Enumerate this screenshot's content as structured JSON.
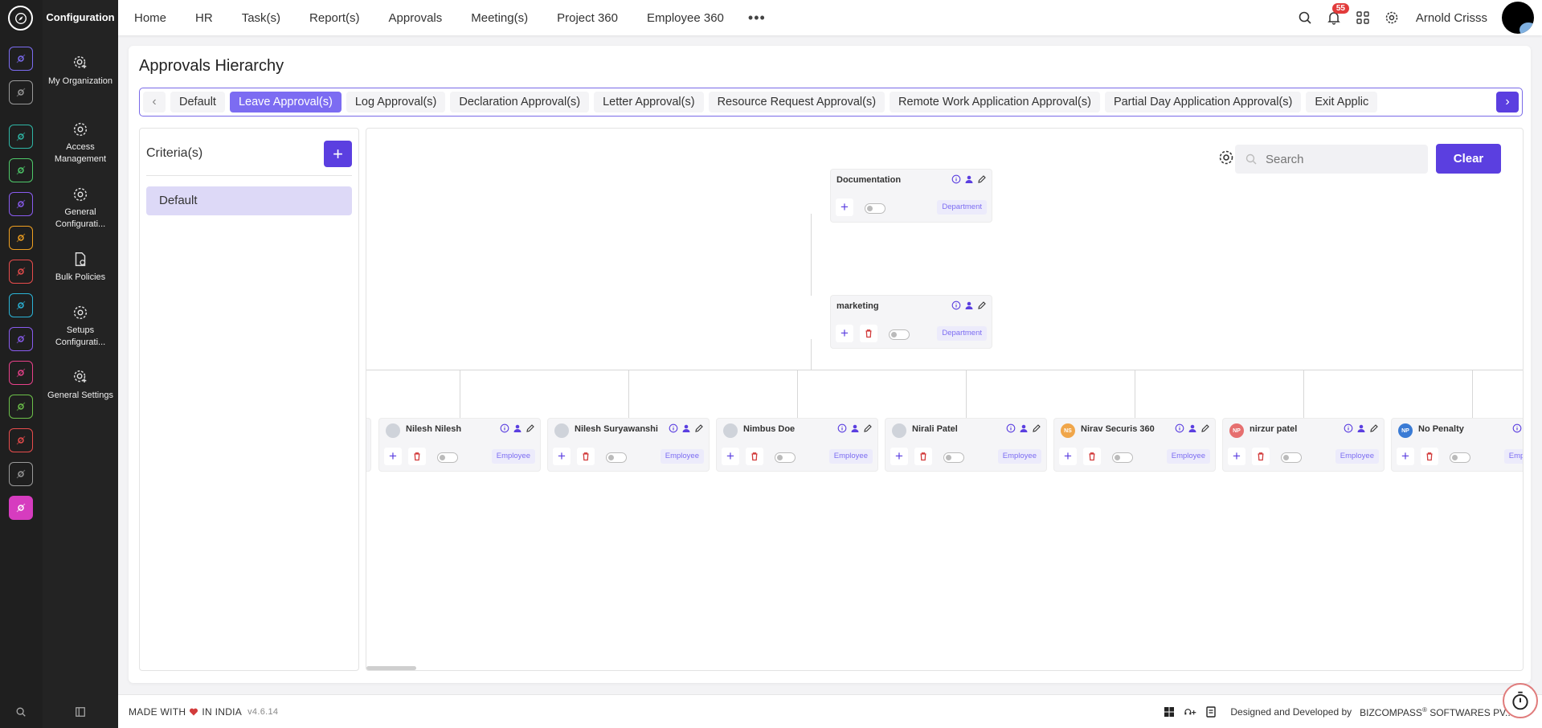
{
  "app": {
    "module_title": "Configuration"
  },
  "colors": {
    "accent": "#5b3fe0",
    "accent_light": "#7c6cf2",
    "danger": "#d23b3b"
  },
  "rail": {
    "icons": [
      {
        "name": "home-icon",
        "color": "#7c6cf2"
      },
      {
        "name": "pin-icon",
        "color": "#9a9a9a"
      },
      {
        "name": "team-icon",
        "color": "#2fb6a5"
      },
      {
        "name": "leaf-icon",
        "color": "#4ec96a"
      },
      {
        "name": "briefcase-icon",
        "color": "#8a5cf0"
      },
      {
        "name": "coins-icon",
        "color": "#f0a020"
      },
      {
        "name": "target-icon",
        "color": "#e84c4c"
      },
      {
        "name": "board-icon",
        "color": "#2bb3d6"
      },
      {
        "name": "plane-icon",
        "color": "#8a5cf0"
      },
      {
        "name": "monitor-icon",
        "color": "#e8418a"
      },
      {
        "name": "document-icon",
        "color": "#6cc04a"
      },
      {
        "name": "support-icon",
        "color": "#e84c4c"
      },
      {
        "name": "building-icon",
        "color": "#9a9a9a"
      },
      {
        "name": "settings-icon",
        "color": "#d63cbf"
      }
    ]
  },
  "modules": [
    {
      "label": "My Organization"
    },
    {
      "label": "Access Management"
    },
    {
      "label": "General Configurati..."
    },
    {
      "label": "Bulk Policies"
    },
    {
      "label": "Setups Configurati..."
    },
    {
      "label": "General Settings"
    }
  ],
  "nav": {
    "items": [
      "Home",
      "HR",
      "Task(s)",
      "Report(s)",
      "Approvals",
      "Meeting(s)",
      "Project 360",
      "Employee 360"
    ],
    "more": "•••",
    "notifications": "55",
    "user": "Arnold Crisss"
  },
  "page": {
    "title": "Approvals Hierarchy"
  },
  "tabs": {
    "items": [
      "Default",
      "Leave Approval(s)",
      "Log Approval(s)",
      "Declaration Approval(s)",
      "Letter Approval(s)",
      "Resource Request Approval(s)",
      "Remote Work Application Approval(s)",
      "Partial Day Application Approval(s)",
      "Exit Applic"
    ],
    "active_index": 1
  },
  "criteria": {
    "title": "Criteria(s)",
    "items": [
      "Default"
    ]
  },
  "canvas": {
    "search_placeholder": "Search",
    "clear_label": "Clear",
    "top_nodes": [
      {
        "name": "Documentation",
        "type": "Department"
      },
      {
        "name": "marketing",
        "type": "Department"
      }
    ],
    "employees": [
      {
        "name": "Nilesh Nilesh",
        "type": "Employee",
        "initials": ""
      },
      {
        "name": "Nilesh Suryawanshi",
        "type": "Employee",
        "initials": ""
      },
      {
        "name": "Nimbus Doe",
        "type": "Employee",
        "initials": ""
      },
      {
        "name": "Nirali Patel",
        "type": "Employee",
        "initials": ""
      },
      {
        "name": "Nirav Securis 360",
        "type": "Employee",
        "initials": "NS"
      },
      {
        "name": "nirzur patel",
        "type": "Employee",
        "initials": "NP"
      },
      {
        "name": "No Penalty",
        "type": "Employee",
        "initials": "NP"
      }
    ]
  },
  "footer": {
    "made_with": "MADE WITH",
    "in_india": "IN INDIA",
    "version": "v4.6.14",
    "designed_by": "Designed and Developed by",
    "company": "BIZCOMPASS",
    "company_suffix": "SOFTWARES PV..."
  }
}
